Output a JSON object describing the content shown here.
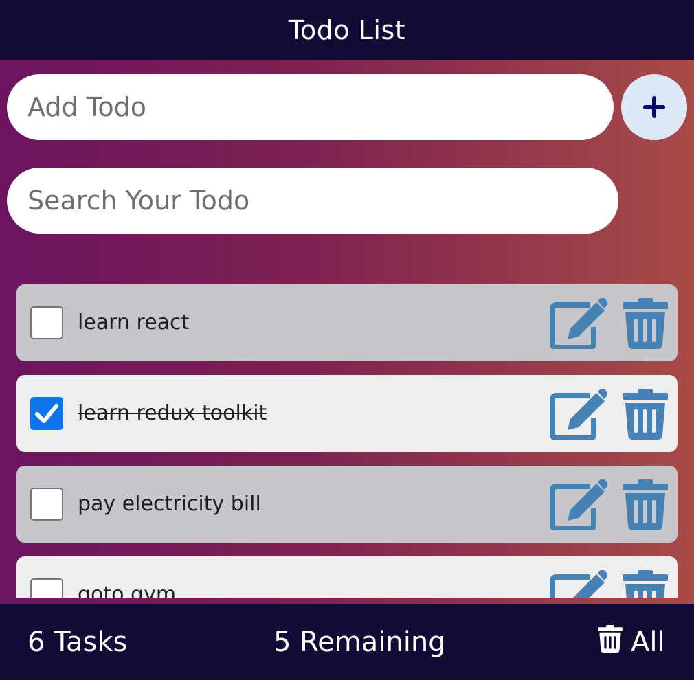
{
  "header": {
    "title": "Todo List"
  },
  "add": {
    "placeholder": "Add Todo",
    "button_icon": "plus-icon"
  },
  "search": {
    "placeholder": "Search Your Todo"
  },
  "todos": [
    {
      "text": "learn react",
      "completed": false
    },
    {
      "text": "learn redux toolkit",
      "completed": true
    },
    {
      "text": "pay electricity bill",
      "completed": false
    },
    {
      "text": "goto gym",
      "completed": false
    }
  ],
  "footer": {
    "tasks_label": "6 Tasks",
    "remaining_label": "5 Remaining",
    "clear_label": "All"
  },
  "colors": {
    "bar_bg": "#110c36",
    "icon_blue": "#4682b4",
    "checkbox_blue": "#0f75ea",
    "row_dark": "#c6c6cb",
    "row_light": "#eeeeee"
  }
}
